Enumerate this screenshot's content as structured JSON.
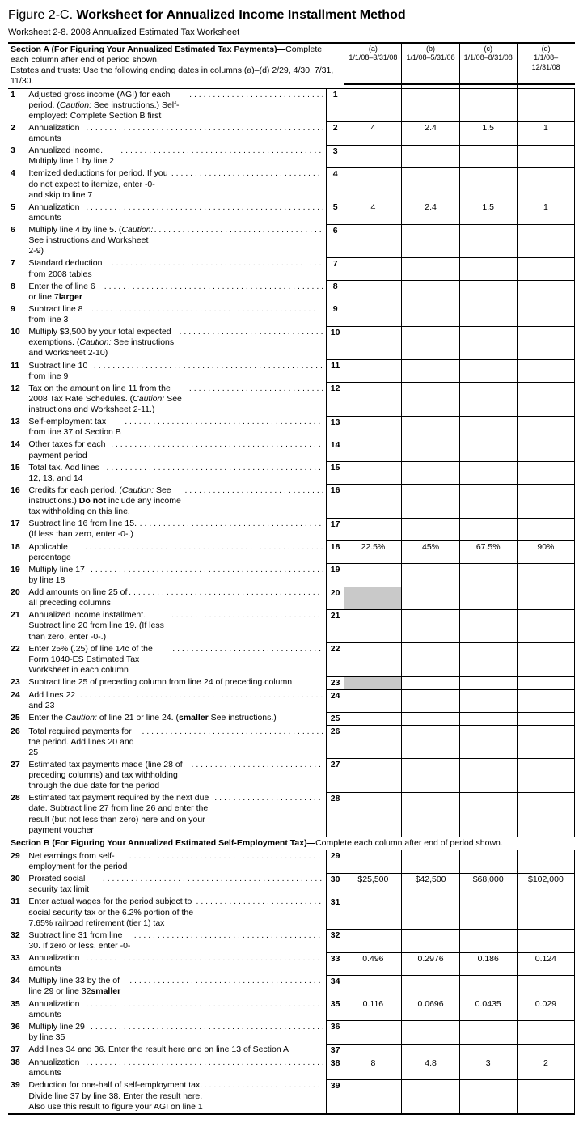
{
  "figure_lead": "Figure 2-C. ",
  "figure_main": "Worksheet for Annualized Income Installment Method",
  "subtitle": "Worksheet 2-8. 2008 Annualized Estimated Tax Worksheet",
  "sectionA": {
    "title": "Section A (For Figuring Your Annualized Estimated Tax Payments)—",
    "tail": "Complete each column after end of period shown.",
    "note": "Estates and trusts: Use the following ending dates in columns (a)–(d) 2/29, 4/30, 7/31, 11/30.",
    "cols": [
      {
        "lbl": "(a)",
        "rng": "1/1/08–3/31/08"
      },
      {
        "lbl": "(b)",
        "rng": "1/1/08–5/31/08"
      },
      {
        "lbl": "(c)",
        "rng": "1/1/08–8/31/08"
      },
      {
        "lbl": "(d)",
        "rng": "1/1/08–12/31/08"
      }
    ]
  },
  "sectionB": {
    "title": "Section B (For Figuring Your Annualized Estimated Self-Employment Tax)—",
    "tail": "Complete each column after end of period shown."
  },
  "rows": [
    {
      "n": "1",
      "desc_pre": "Adjusted gross income (AGI) for each period. (",
      "caution": "Caution:",
      "desc_post": " See instructions.) Self-employed: Complete Section B first",
      "r": "1",
      "v": [
        "",
        "",
        "",
        ""
      ],
      "box": true,
      "dots": true
    },
    {
      "n": "2",
      "desc": "Annualization amounts",
      "r": "2",
      "v": [
        "4",
        "2.4",
        "1.5",
        "1"
      ],
      "box": true,
      "dots": true
    },
    {
      "n": "3",
      "desc": "Annualized income. Multiply line 1 by line 2",
      "r": "3",
      "v": [
        "",
        "",
        "",
        ""
      ],
      "box": true,
      "dots": true
    },
    {
      "n": "4",
      "desc": "Itemized deductions for period. If you do not expect to itemize, enter -0- and skip to line 7",
      "r": "4",
      "v": [
        "",
        "",
        "",
        ""
      ],
      "box": true,
      "dots": true
    },
    {
      "n": "5",
      "desc": "Annualization amounts",
      "r": "5",
      "v": [
        "4",
        "2.4",
        "1.5",
        "1"
      ],
      "box": true,
      "dots": true
    },
    {
      "n": "6",
      "desc_pre": "Multiply line 4 by line 5. (",
      "caution": "Caution:",
      "desc_post": " See instructions and Worksheet 2-9)",
      "r": "6",
      "v": [
        "",
        "",
        "",
        ""
      ],
      "box": true,
      "dots": true
    },
    {
      "n": "7",
      "desc": "Standard deduction from 2008 tables",
      "r": "7",
      "v": [
        "",
        "",
        "",
        ""
      ],
      "box": true,
      "dots": true
    },
    {
      "n": "8",
      "desc_pre": "Enter the ",
      "bold": "larger",
      "desc_post": " of line 6 or line 7",
      "r": "8",
      "v": [
        "",
        "",
        "",
        ""
      ],
      "box": true,
      "dots": true
    },
    {
      "n": "9",
      "desc": "Subtract line 8 from line 3",
      "r": "9",
      "v": [
        "",
        "",
        "",
        ""
      ],
      "box": true,
      "dots": true
    },
    {
      "n": "10",
      "desc_pre": "Multiply $3,500 by your total expected exemptions. (",
      "caution": "Caution:",
      "desc_post": " See instructions and Worksheet 2-10)",
      "r": "10",
      "v": [
        "",
        "",
        "",
        ""
      ],
      "box": true,
      "dots": true
    },
    {
      "n": "11",
      "desc": "Subtract line 10 from line 9",
      "r": "11",
      "v": [
        "",
        "",
        "",
        ""
      ],
      "box": true,
      "dots": true
    },
    {
      "n": "12",
      "desc_pre": "Tax on the amount on line 11 from the 2008 Tax Rate Schedules. (",
      "caution": "Caution:",
      "desc_post": " See instructions and Worksheet 2-11.)",
      "r": "12",
      "v": [
        "",
        "",
        "",
        ""
      ],
      "box": true,
      "dots": true
    },
    {
      "n": "13",
      "desc": "Self-employment tax from line 37 of Section B",
      "r": "13",
      "v": [
        "",
        "",
        "",
        ""
      ],
      "box": true,
      "dots": true
    },
    {
      "n": "14",
      "desc": "Other taxes for each payment period",
      "r": "14",
      "v": [
        "",
        "",
        "",
        ""
      ],
      "box": true,
      "dots": true
    },
    {
      "n": "15",
      "desc": "Total tax. Add lines 12, 13, and 14",
      "r": "15",
      "v": [
        "",
        "",
        "",
        ""
      ],
      "box": true,
      "dots": true
    },
    {
      "n": "16",
      "desc_pre": "Credits for each period. (",
      "caution": "Caution:",
      "desc_post": " See instructions.) ",
      "bold": "Do not",
      "desc_post2": " include any income tax withholding on this line.",
      "r": "16",
      "v": [
        "",
        "",
        "",
        ""
      ],
      "box": true,
      "dots": true
    },
    {
      "n": "17",
      "desc": "Subtract line 16 from line 15. (If less than zero, enter -0-.)",
      "r": "17",
      "v": [
        "",
        "",
        "",
        ""
      ],
      "box": true,
      "dots": true
    },
    {
      "n": "18",
      "desc": "Applicable percentage",
      "r": "18",
      "v": [
        "22.5%",
        "45%",
        "67.5%",
        "90%"
      ],
      "box": true,
      "dots": true
    },
    {
      "n": "19",
      "desc": "Multiply line 17 by line 18",
      "r": "19",
      "v": [
        "",
        "",
        "",
        ""
      ],
      "box": true,
      "dots": true
    },
    {
      "n": "20",
      "desc": "Add amounts on line 25 of all preceding columns",
      "r": "20",
      "v": [
        "",
        "",
        "",
        ""
      ],
      "box": true,
      "shaded0": true,
      "dots": true
    },
    {
      "n": "21",
      "desc": "Annualized income installment. Subtract line 20 from line 19. (If less than zero, enter -0-.)",
      "r": "21",
      "v": [
        "",
        "",
        "",
        ""
      ],
      "box": true,
      "dots": true
    },
    {
      "n": "22",
      "desc": "Enter 25% (.25) of line 14c of the Form 1040-ES Estimated Tax Worksheet in each column",
      "r": "22",
      "v": [
        "",
        "",
        "",
        ""
      ],
      "box": true,
      "dots": true
    },
    {
      "n": "23",
      "desc": "Subtract line 25 of preceding column from line 24 of preceding column",
      "r": "23",
      "v": [
        "",
        "",
        "",
        ""
      ],
      "box": true,
      "shaded0": true,
      "dots": false
    },
    {
      "n": "24",
      "desc": "Add lines 22 and 23",
      "r": "24",
      "v": [
        "",
        "",
        "",
        ""
      ],
      "box": true,
      "dots": true
    },
    {
      "n": "25",
      "desc_pre": "Enter the ",
      "bold": "smaller",
      "desc_post": " of line 21 or line 24. (",
      "caution": "Caution:",
      "desc_post2": " See instructions.)",
      "r": "25",
      "v": [
        "",
        "",
        "",
        ""
      ],
      "box": true,
      "dots": false
    },
    {
      "n": "26",
      "desc": "Total required payments for the period. Add lines 20 and 25",
      "r": "26",
      "v": [
        "",
        "",
        "",
        ""
      ],
      "box": true,
      "dots": true
    },
    {
      "n": "27",
      "desc": "Estimated tax payments made (line 28 of preceding columns) and tax withholding through the due date for the period",
      "r": "27",
      "v": [
        "",
        "",
        "",
        ""
      ],
      "box": true,
      "dots": true
    },
    {
      "n": "28",
      "desc": "Estimated tax payment required by the next due date. Subtract line 27 from line 26 and enter the result (but not less than zero) here and on your payment voucher",
      "r": "28",
      "v": [
        "",
        "",
        "",
        ""
      ],
      "box": true,
      "dots": true
    }
  ],
  "rowsB": [
    {
      "n": "29",
      "desc": "Net earnings from self-employment for the period",
      "r": "29",
      "v": [
        "",
        "",
        "",
        ""
      ],
      "box": true,
      "dots": true
    },
    {
      "n": "30",
      "desc": "Prorated social security tax limit",
      "r": "30",
      "v": [
        "$25,500",
        "$42,500",
        "$68,000",
        "$102,000"
      ],
      "box": true,
      "dots": true
    },
    {
      "n": "31",
      "desc": "Enter actual wages for the period subject to social security tax or the 6.2% portion of the 7.65% railroad retirement (tier 1) tax",
      "r": "31",
      "v": [
        "",
        "",
        "",
        ""
      ],
      "box": true,
      "dots": true
    },
    {
      "n": "32",
      "desc": "Subtract line 31 from line 30. If zero or less, enter -0-",
      "r": "32",
      "v": [
        "",
        "",
        "",
        ""
      ],
      "box": true,
      "dots": true
    },
    {
      "n": "33",
      "desc": "Annualization amounts",
      "r": "33",
      "v": [
        "0.496",
        "0.2976",
        "0.186",
        "0.124"
      ],
      "box": true,
      "dots": true
    },
    {
      "n": "34",
      "desc_pre": "Multiply line 33 by the ",
      "bold": "smaller",
      "desc_post": " of line 29 or line 32",
      "r": "34",
      "v": [
        "",
        "",
        "",
        ""
      ],
      "box": true,
      "dots": true
    },
    {
      "n": "35",
      "desc": "Annualization amounts",
      "r": "35",
      "v": [
        "0.116",
        "0.0696",
        "0.0435",
        "0.029"
      ],
      "box": true,
      "dots": true
    },
    {
      "n": "36",
      "desc": "Multiply line 29 by line 35",
      "r": "36",
      "v": [
        "",
        "",
        "",
        ""
      ],
      "box": true,
      "dots": true
    },
    {
      "n": "37",
      "desc": "Add lines 34 and 36. Enter the result here and on line 13 of Section A",
      "r": "37",
      "v": [
        "",
        "",
        "",
        ""
      ],
      "box": true,
      "dots": false
    },
    {
      "n": "38",
      "desc": "Annualization amounts",
      "r": "38",
      "v": [
        "8",
        "4.8",
        "3",
        "2"
      ],
      "box": true,
      "dots": true
    },
    {
      "n": "39",
      "desc": "Deduction for one-half of self-employment tax. Divide line 37 by line 38. Enter the result here. Also use this result to figure your AGI on line 1",
      "r": "39",
      "v": [
        "",
        "",
        "",
        ""
      ],
      "box": true,
      "dots": true,
      "last": true
    }
  ]
}
